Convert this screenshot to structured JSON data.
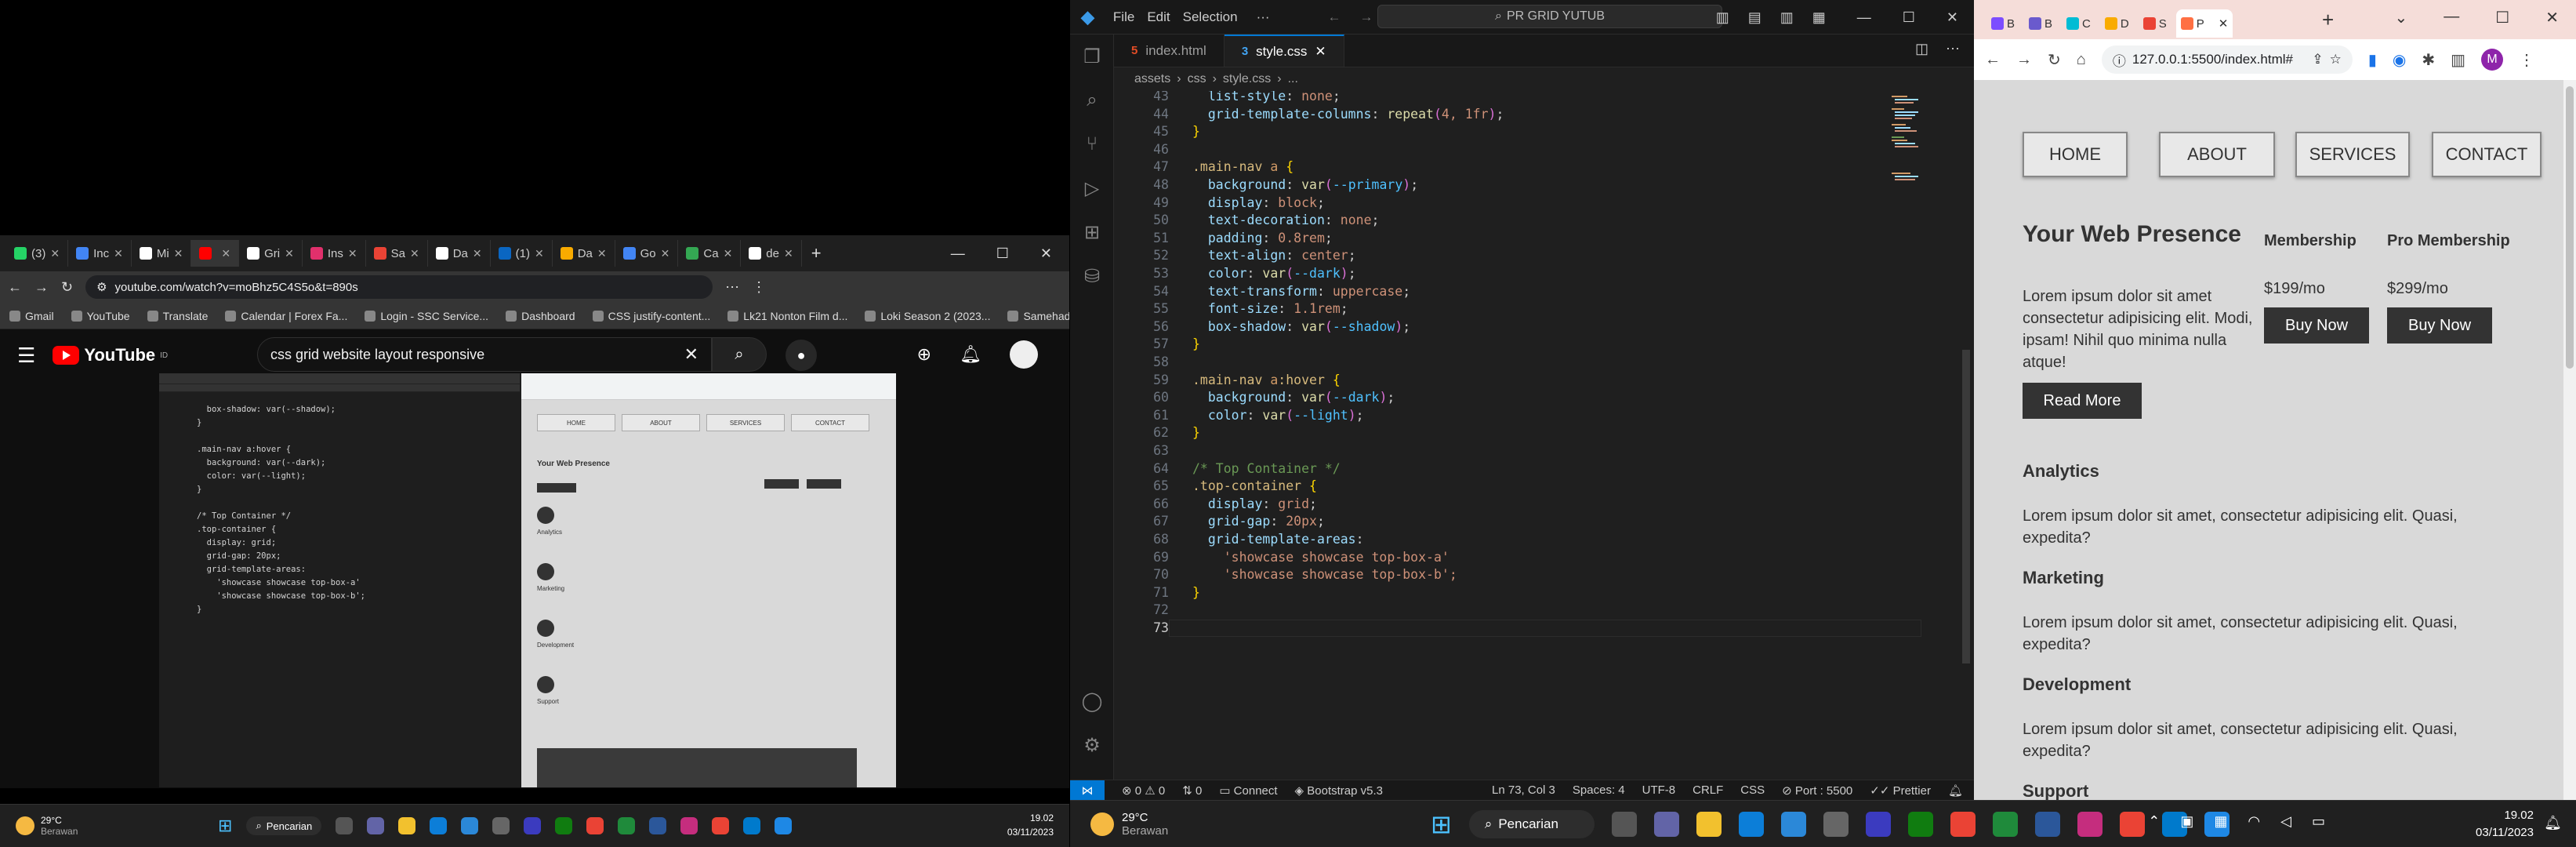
{
  "youtube_window": {
    "tabs": [
      {
        "label": "(3)",
        "color": "#25d366"
      },
      {
        "label": "Inc",
        "color": "#4285f4"
      },
      {
        "label": "Mi",
        "color": "#ffffff"
      },
      {
        "label": "",
        "color": "#ff0000",
        "active": true
      },
      {
        "label": "Gri",
        "color": "#ffffff"
      },
      {
        "label": "Ins",
        "color": "#e1306c"
      },
      {
        "label": "Sa",
        "color": "#ea4335"
      },
      {
        "label": "Da",
        "color": "#ffffff"
      },
      {
        "label": "(1)",
        "color": "#0a66c2"
      },
      {
        "label": "Da",
        "color": "#f9ab00"
      },
      {
        "label": "Go",
        "color": "#4285f4"
      },
      {
        "label": "Ca",
        "color": "#34a853"
      },
      {
        "label": "de",
        "color": "#ffffff"
      }
    ],
    "url": "youtube.com/watch?v=moBhz5C4S5o&t=890s",
    "bookmarks": [
      "Gmail",
      "YouTube",
      "Translate",
      "Calendar | Forex Fa...",
      "Login - SSC Service...",
      "Dashboard",
      "CSS justify-content...",
      "Lk21 Nonton Film d...",
      "Loki Season 2 (2023...",
      "Samehadaku - Non..."
    ],
    "logo_text": "YouTube",
    "logo_region": "ID",
    "search_value": "css grid website layout responsive",
    "video": {
      "code_lines": [
        "  box-shadow: var(--shadow);",
        "}",
        "",
        ".main-nav a:hover {",
        "  background: var(--dark);",
        "  color: var(--light);",
        "}",
        "",
        "/* Top Container */",
        ".top-container {",
        "  display: grid;",
        "  grid-gap: 20px;",
        "  grid-template-areas:",
        "    'showcase showcase top-box-a'",
        "    'showcase showcase top-box-b';",
        "}"
      ],
      "nav": [
        "HOME",
        "ABOUT",
        "SERVICES",
        "CONTACT"
      ],
      "title": "Your Web Presence",
      "sections": [
        "Analytics",
        "Marketing",
        "Development",
        "Support"
      ]
    }
  },
  "taskbar_left": {
    "weather_temp": "29°C",
    "weather_desc": "Berawan",
    "search": "Pencarian",
    "time": "19.02",
    "date": "03/11/2023"
  },
  "vscode": {
    "menu": [
      "File",
      "Edit",
      "Selection",
      "···"
    ],
    "command_center": "PR GRID YUTUB",
    "tabs": [
      {
        "label": "index.html",
        "icon": "html"
      },
      {
        "label": "style.css",
        "icon": "css",
        "active": true
      }
    ],
    "breadcrumb": [
      "assets",
      "css",
      "style.css",
      "..."
    ],
    "code": [
      {
        "n": "43",
        "t": "  list-style: none;"
      },
      {
        "n": "44",
        "t": "  grid-template-columns: repeat(4, 1fr);"
      },
      {
        "n": "45",
        "t": "}"
      },
      {
        "n": "46",
        "t": ""
      },
      {
        "n": "47",
        "t": ".main-nav a {"
      },
      {
        "n": "48",
        "t": "  background: var(--primary);"
      },
      {
        "n": "49",
        "t": "  display: block;"
      },
      {
        "n": "50",
        "t": "  text-decoration: none;"
      },
      {
        "n": "51",
        "t": "  padding: 0.8rem;"
      },
      {
        "n": "52",
        "t": "  text-align: center;"
      },
      {
        "n": "53",
        "t": "  color: var(--dark);"
      },
      {
        "n": "54",
        "t": "  text-transform: uppercase;"
      },
      {
        "n": "55",
        "t": "  font-size: 1.1rem;"
      },
      {
        "n": "56",
        "t": "  box-shadow: var(--shadow);"
      },
      {
        "n": "57",
        "t": "}"
      },
      {
        "n": "58",
        "t": ""
      },
      {
        "n": "59",
        "t": ".main-nav a:hover {"
      },
      {
        "n": "60",
        "t": "  background: var(--dark);"
      },
      {
        "n": "61",
        "t": "  color: var(--light);"
      },
      {
        "n": "62",
        "t": "}"
      },
      {
        "n": "63",
        "t": ""
      },
      {
        "n": "64",
        "t": "/* Top Container */"
      },
      {
        "n": "65",
        "t": ".top-container {"
      },
      {
        "n": "66",
        "t": "  display: grid;"
      },
      {
        "n": "67",
        "t": "  grid-gap: 20px;"
      },
      {
        "n": "68",
        "t": "  grid-template-areas:"
      },
      {
        "n": "69",
        "t": "    'showcase showcase top-box-a'"
      },
      {
        "n": "70",
        "t": "    'showcase showcase top-box-b';"
      },
      {
        "n": "71",
        "t": "}"
      },
      {
        "n": "72",
        "t": ""
      },
      {
        "n": "73",
        "t": ""
      }
    ],
    "status": {
      "errors": "0",
      "warnings": "0",
      "ports": "0",
      "connect": "Connect",
      "bootstrap": "Bootstrap v5.3",
      "cursor": "Ln 73, Col 3",
      "spaces": "Spaces: 4",
      "encoding": "UTF-8",
      "eol": "CRLF",
      "language": "CSS",
      "port": "Port : 5500",
      "prettier": "Prettier"
    }
  },
  "browser": {
    "tabs": [
      {
        "label": "B",
        "color": "#7c4dff"
      },
      {
        "label": "B",
        "color": "#6a5acd"
      },
      {
        "label": "C",
        "color": "#00bcd4"
      },
      {
        "label": "D",
        "color": "#f9ab00"
      },
      {
        "label": "S",
        "color": "#ea4335"
      },
      {
        "label": "P",
        "color": "#ff7043",
        "active": true
      }
    ],
    "url": "127.0.0.1:5500/index.html#",
    "profile": "M",
    "nav": [
      "HOME",
      "ABOUT",
      "SERVICES",
      "CONTACT"
    ],
    "showcase": {
      "title": "Your Web Presence",
      "text": "Lorem ipsum dolor sit amet consectetur adipisicing elit. Modi, ipsam! Nihil quo minima nulla atque!",
      "button": "Read More"
    },
    "top_boxes": [
      {
        "title": "Membership",
        "price": "$199/mo",
        "button": "Buy Now"
      },
      {
        "title": "Pro Membership",
        "price": "$299/mo",
        "button": "Buy Now"
      }
    ],
    "sections": [
      {
        "title": "Analytics",
        "text": "Lorem ipsum dolor sit amet, consectetur adipisicing elit. Quasi, expedita?"
      },
      {
        "title": "Marketing",
        "text": "Lorem ipsum dolor sit amet, consectetur adipisicing elit. Quasi, expedita?"
      },
      {
        "title": "Development",
        "text": "Lorem ipsum dolor sit amet, consectetur adipisicing elit. Quasi, expedita?"
      },
      {
        "title": "Support",
        "text": ""
      }
    ]
  },
  "taskbar_right": {
    "weather_temp": "29°C",
    "weather_desc": "Berawan",
    "search": "Pencarian",
    "time": "19.02",
    "date": "03/11/2023"
  }
}
